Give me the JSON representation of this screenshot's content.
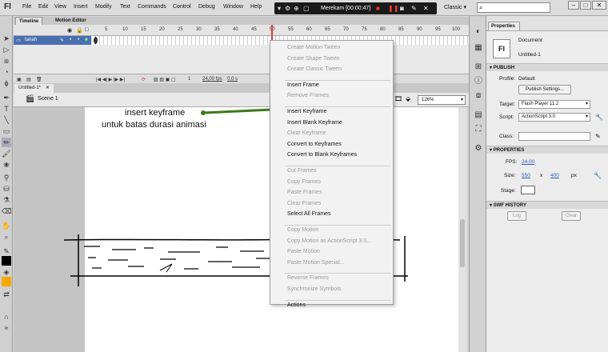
{
  "app": {
    "logo": "Fl"
  },
  "menu": [
    "File",
    "Edit",
    "View",
    "Insert",
    "Modify",
    "Text",
    "Commands",
    "Control",
    "Debug",
    "Window",
    "Help"
  ],
  "recorder": {
    "label": "Merekam [00:00:47]"
  },
  "workspace": "Classic",
  "search": {
    "icon": "search-icon"
  },
  "timeline": {
    "tabs": [
      "Timeline",
      "Motion Editor"
    ],
    "frame_numbers": [
      "5",
      "10",
      "15",
      "20",
      "25",
      "30",
      "35",
      "40",
      "45",
      "50",
      "55",
      "60",
      "65",
      "70",
      "75",
      "80",
      "85",
      "90",
      "95",
      "100"
    ],
    "layer_name": "tanah",
    "footer": {
      "frame": "1",
      "fps": "24,00 fps",
      "time": "0,0 s"
    }
  },
  "document": {
    "tab": "Untitled-1*",
    "scene": "Scene 1",
    "zoom": "126%"
  },
  "annotation": {
    "line1": "insert keyframe",
    "line2": "untuk batas durasi animasi",
    "arrow_color": "#3d7a1a"
  },
  "context_menu": [
    {
      "label": "Create Motion Tween",
      "enabled": false
    },
    {
      "label": "Create Shape Tween",
      "enabled": false
    },
    {
      "label": "Create Classic Tween",
      "enabled": false
    },
    {
      "sep": true
    },
    {
      "label": "Insert Frame",
      "enabled": true
    },
    {
      "label": "Remove Frames",
      "enabled": false
    },
    {
      "sep": true
    },
    {
      "label": "Insert Keyframe",
      "enabled": true
    },
    {
      "label": "Insert Blank Keyframe",
      "enabled": true
    },
    {
      "label": "Clear Keyframe",
      "enabled": false
    },
    {
      "label": "Convert to Keyframes",
      "enabled": true
    },
    {
      "label": "Convert to Blank Keyframes",
      "enabled": true
    },
    {
      "sep": true
    },
    {
      "label": "Cut Frames",
      "enabled": false
    },
    {
      "label": "Copy Frames",
      "enabled": false
    },
    {
      "label": "Paste Frames",
      "enabled": false
    },
    {
      "label": "Clear Frames",
      "enabled": false
    },
    {
      "label": "Select All Frames",
      "enabled": true
    },
    {
      "sep": true
    },
    {
      "label": "Copy Motion",
      "enabled": false
    },
    {
      "label": "Copy Motion as ActionScript 3.0...",
      "enabled": false
    },
    {
      "label": "Paste Motion",
      "enabled": false
    },
    {
      "label": "Paste Motion Special...",
      "enabled": false
    },
    {
      "sep": true
    },
    {
      "label": "Reverse Frames",
      "enabled": false
    },
    {
      "label": "Synchronize Symbols",
      "enabled": false
    },
    {
      "sep": true
    },
    {
      "label": "Actions",
      "enabled": true
    }
  ],
  "properties": {
    "tab": "Properties",
    "doc_type": "Document",
    "doc_name": "Untitled-1",
    "publish_head": "PUBLISH",
    "profile_label": "Profile:",
    "profile_value": "Default",
    "publish_settings": "Publish Settings...",
    "target_label": "Target:",
    "target_value": "Flash Player 11.2",
    "script_label": "Script:",
    "script_value": "ActionScript 3.0",
    "class_label": "Class:",
    "class_value": "",
    "props_head": "PROPERTIES",
    "fps_label": "FPS:",
    "fps_value": "24,00",
    "size_label": "Size:",
    "width": "550",
    "x_sep": "x",
    "height": "400",
    "unit": "px",
    "stage_label": "Stage:",
    "stage_color": "#ffffff",
    "swf_head": "SWF HISTORY",
    "log_btn": "Log",
    "clear_btn": "Clear"
  }
}
